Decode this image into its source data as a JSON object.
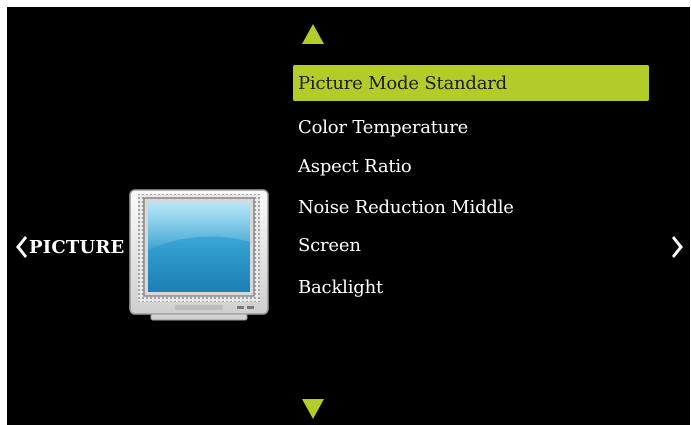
{
  "colors": {
    "accent": "#b4cc2a",
    "background": "#000000",
    "text": "#ffffff",
    "selected_text": "#1b1b1b"
  },
  "navigation": {
    "up_icon": "triangle-up-icon",
    "down_icon": "triangle-down-icon",
    "prev_icon": "chevron-left-icon",
    "next_icon": "chevron-right-icon"
  },
  "category": {
    "label": "PICTURE",
    "icon": "tv-icon"
  },
  "menu": {
    "selected_index": 0,
    "items": [
      {
        "label": "Picture Mode Standard"
      },
      {
        "label": "Color Temperature"
      },
      {
        "label": "Aspect Ratio"
      },
      {
        "label": "Noise Reduction Middle"
      },
      {
        "label": "Screen"
      },
      {
        "label": "Backlight"
      }
    ]
  }
}
